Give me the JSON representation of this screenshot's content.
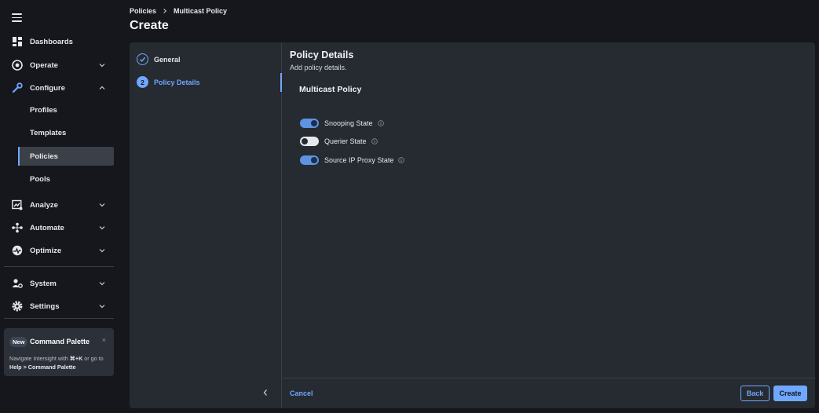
{
  "breadcrumb": {
    "parent": "Policies",
    "current": "Multicast Policy"
  },
  "page_title": "Create",
  "sidebar": {
    "items": [
      {
        "label": "Dashboards",
        "icon": "dashboard-icon"
      },
      {
        "label": "Operate",
        "icon": "operate-icon"
      },
      {
        "label": "Configure",
        "icon": "configure-icon"
      },
      {
        "label": "Analyze",
        "icon": "analyze-icon"
      },
      {
        "label": "Automate",
        "icon": "automate-icon"
      },
      {
        "label": "Optimize",
        "icon": "optimize-icon"
      },
      {
        "label": "System",
        "icon": "system-icon"
      },
      {
        "label": "Settings",
        "icon": "settings-icon"
      }
    ],
    "configure_sub": [
      {
        "label": "Profiles"
      },
      {
        "label": "Templates"
      },
      {
        "label": "Policies",
        "active": true
      },
      {
        "label": "Pools"
      }
    ]
  },
  "command_palette": {
    "badge": "New",
    "title": "Command Palette",
    "close": "×",
    "text_prefix": "Navigate Intersight with ",
    "shortcut": "⌘+K",
    "text_middle": " or go to ",
    "path": "Help > Command Palette"
  },
  "steps": [
    {
      "number": "1",
      "label": "General",
      "status": "done"
    },
    {
      "number": "2",
      "label": "Policy Details",
      "status": "active"
    }
  ],
  "content": {
    "title": "Policy Details",
    "subtitle": "Add policy details.",
    "section": "Multicast Policy",
    "toggles": [
      {
        "label": "Snooping State",
        "on": true
      },
      {
        "label": "Querier State",
        "on": false
      },
      {
        "label": "Source IP Proxy State",
        "on": true
      }
    ]
  },
  "footer": {
    "cancel": "Cancel",
    "back": "Back",
    "create": "Create"
  },
  "colors": {
    "accent": "#6fa8ff",
    "background": "#15171c",
    "panel": "#262a31"
  }
}
